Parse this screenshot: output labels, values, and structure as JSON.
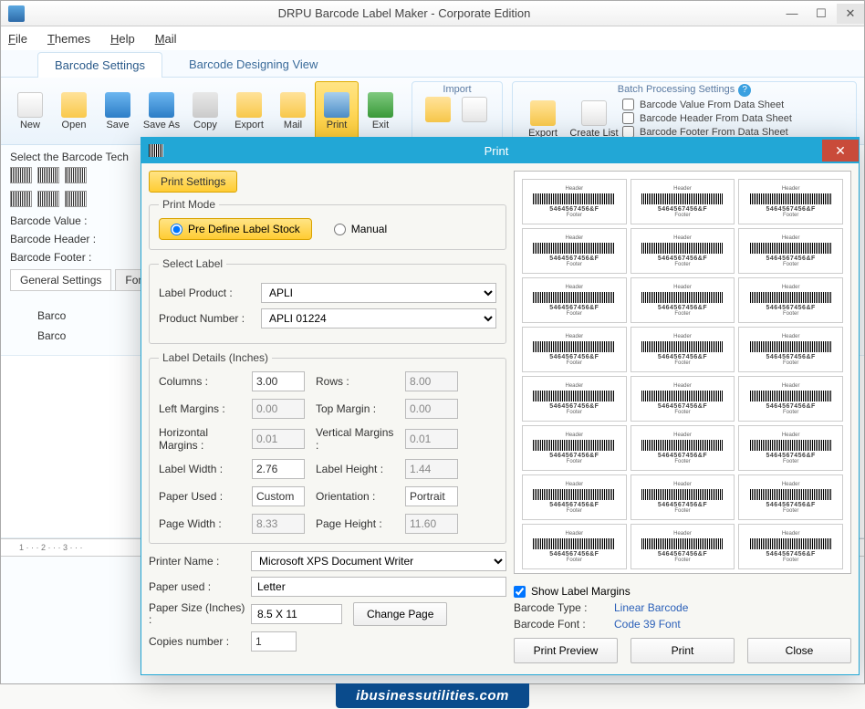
{
  "window": {
    "title": "DRPU Barcode Label Maker - Corporate Edition"
  },
  "menu": {
    "file": "File",
    "themes": "Themes",
    "help": "Help",
    "mail": "Mail"
  },
  "main_tabs": {
    "settings": "Barcode Settings",
    "design": "Barcode Designing View"
  },
  "ribbon": {
    "new": "New",
    "open": "Open",
    "save": "Save",
    "saveas": "Save As",
    "copy": "Copy",
    "export": "Export",
    "mail": "Mail",
    "print": "Print",
    "exit": "Exit",
    "import_group": "Import",
    "batch_group": "Batch Processing Settings",
    "batch_export": "Export",
    "batch_create": "Create List",
    "batch_opt1": "Barcode Value From Data Sheet",
    "batch_opt2": "Barcode Header From Data Sheet",
    "batch_opt3": "Barcode Footer From Data Sheet"
  },
  "under": {
    "select_tech": "Select the Barcode Tech",
    "value_lbl": "Barcode Value :",
    "header_lbl": "Barcode Header :",
    "footer_lbl": "Barcode Footer :",
    "tab1": "General Settings",
    "tab2": "Fon",
    "prop1": "Barco",
    "prop2": "Barco"
  },
  "dialog": {
    "title": "Print",
    "tab": "Print Settings",
    "print_mode_legend": "Print Mode",
    "radio_predef": "Pre Define Label Stock",
    "radio_manual": "Manual",
    "select_label_legend": "Select Label",
    "label_product_lbl": "Label Product :",
    "label_product_val": "APLI",
    "product_number_lbl": "Product Number :",
    "product_number_val": "APLI 01224",
    "label_details_legend": "Label Details (Inches)",
    "columns_lbl": "Columns :",
    "columns_val": "3.00",
    "rows_lbl": "Rows :",
    "rows_val": "8.00",
    "lmargin_lbl": "Left Margins :",
    "lmargin_val": "0.00",
    "tmargin_lbl": "Top Margin :",
    "tmargin_val": "0.00",
    "hmargin_lbl": "Horizontal Margins :",
    "hmargin_val": "0.01",
    "vmargin_lbl": "Vertical Margins :",
    "vmargin_val": "0.01",
    "lwidth_lbl": "Label Width :",
    "lwidth_val": "2.76",
    "lheight_lbl": "Label Height :",
    "lheight_val": "1.44",
    "paperused_lbl": "Paper Used :",
    "paperused_val": "Custom",
    "orient_lbl": "Orientation :",
    "orient_val": "Portrait",
    "pwidth_lbl": "Page Width :",
    "pwidth_val": "8.33",
    "pheight_lbl": "Page Height :",
    "pheight_val": "11.60",
    "printer_lbl": "Printer Name :",
    "printer_val": "Microsoft XPS Document Writer",
    "paperused2_lbl": "Paper used :",
    "paperused2_val": "Letter",
    "papersize_lbl": "Paper Size (Inches) :",
    "papersize_val": "8.5 X 11",
    "changepage_btn": "Change Page",
    "copies_lbl": "Copies number :",
    "copies_val": "1",
    "preview_header": "Header",
    "preview_num": "5464567456&F",
    "preview_footer": "Footer",
    "show_margins_lbl": "Show Label Margins",
    "bctype_lbl": "Barcode Type :",
    "bctype_val": "Linear Barcode",
    "bcfont_lbl": "Barcode Font :",
    "bcfont_val": "Code 39 Font",
    "btn_preview": "Print Preview",
    "btn_print": "Print",
    "btn_close": "Close"
  },
  "footer": {
    "logo": "ibusinessutilities.com"
  }
}
